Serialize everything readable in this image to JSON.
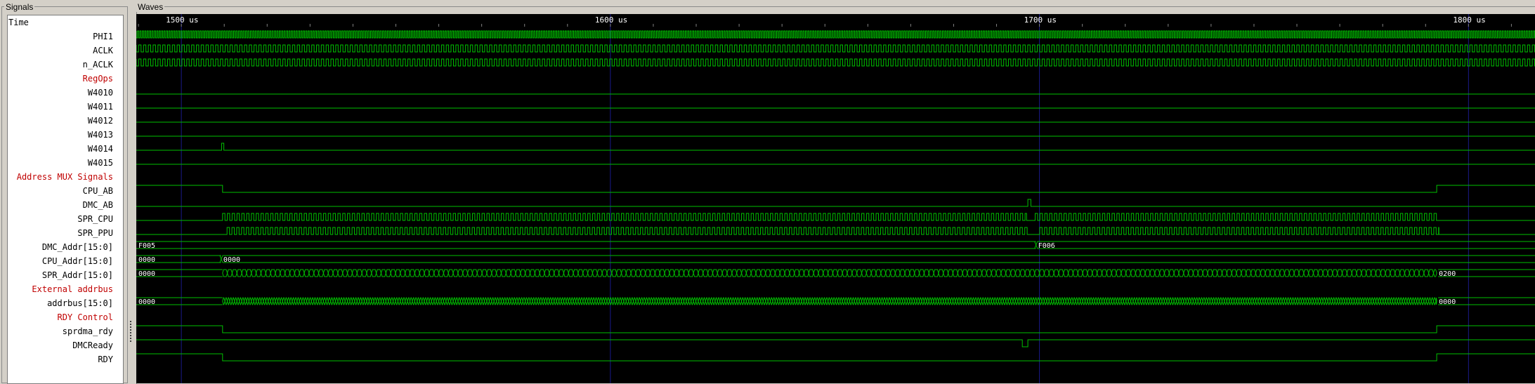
{
  "panes": {
    "signals_title": "Signals",
    "waves_title": "Waves"
  },
  "time_header": "Time",
  "colors": {
    "wave": "#00c000",
    "background": "#000000",
    "grid": "#1a1a8a",
    "section_text": "#c00000"
  },
  "timeline": {
    "start_us": 1489.5,
    "end_us": 1815.5,
    "ticks": [
      {
        "t": 1500,
        "label": "1500 us"
      },
      {
        "t": 1600,
        "label": "1600 us"
      },
      {
        "t": 1700,
        "label": "1700 us"
      },
      {
        "t": 1800,
        "label": "1800 us"
      }
    ]
  },
  "signals": [
    {
      "name": "PHI1",
      "type": "clock",
      "period_us": 0.56
    },
    {
      "name": "ACLK",
      "type": "clock",
      "period_us": 1.12
    },
    {
      "name": "n_ACLK",
      "type": "clock",
      "period_us": 1.12
    },
    {
      "name": "RegOps",
      "type": "section"
    },
    {
      "name": "W4010",
      "type": "low"
    },
    {
      "name": "W4011",
      "type": "low"
    },
    {
      "name": "W4012",
      "type": "low"
    },
    {
      "name": "W4013",
      "type": "low"
    },
    {
      "name": "W4014",
      "type": "pulses",
      "pulses": [
        [
          1509.4,
          1509.9
        ]
      ]
    },
    {
      "name": "W4015",
      "type": "low"
    },
    {
      "name": "Address MUX Signals",
      "type": "section"
    },
    {
      "name": "CPU_AB",
      "type": "edges",
      "initial": 1,
      "edges": [
        1509.6,
        1792.6
      ]
    },
    {
      "name": "DMC_AB",
      "type": "pulses",
      "pulses": [
        [
          1697.3,
          1698.0
        ]
      ]
    },
    {
      "name": "SPR_CPU",
      "type": "clockwin",
      "period_us": 1.12,
      "windows": [
        [
          1509.6,
          1697.0
        ],
        [
          1699.0,
          1792.6
        ]
      ]
    },
    {
      "name": "SPR_PPU",
      "type": "clockwin",
      "period_us": 1.12,
      "phase_us": 0.56,
      "windows": [
        [
          1510.1,
          1697.6
        ],
        [
          1699.5,
          1793.1
        ]
      ]
    },
    {
      "name": "DMC_Addr[15:0]",
      "type": "bus",
      "segments": [
        {
          "t": 1489.5,
          "label": "F005"
        },
        {
          "t": 1699.2,
          "label": "F006"
        }
      ]
    },
    {
      "name": "CPU_Addr[15:0]",
      "type": "bus",
      "segments": [
        {
          "t": 1489.5,
          "label": "0000"
        },
        {
          "t": 1509.3,
          "label": "0000"
        }
      ]
    },
    {
      "name": "SPR_Addr[15:0]",
      "type": "bus",
      "segments": [
        {
          "t": 1489.5,
          "label": "0000"
        },
        {
          "t": 1792.6,
          "label": "0200"
        }
      ],
      "busy": [
        1509.6,
        1792.6
      ],
      "busy_period_us": 1.12
    },
    {
      "name": "External addrbus",
      "type": "section"
    },
    {
      "name": "addrbus[15:0]",
      "type": "bus",
      "segments": [
        {
          "t": 1489.5,
          "label": "0000"
        },
        {
          "t": 1792.6,
          "label": "0000"
        }
      ],
      "busy": [
        1509.6,
        1792.6
      ],
      "busy_period_us": 0.56
    },
    {
      "name": "RDY Control",
      "type": "section"
    },
    {
      "name": "sprdma_rdy",
      "type": "edges",
      "initial": 1,
      "edges": [
        1509.6,
        1792.6
      ]
    },
    {
      "name": "DMCReady",
      "type": "edges",
      "initial": 1,
      "edges": [
        1696.0,
        1697.3
      ]
    },
    {
      "name": "RDY",
      "type": "edges",
      "initial": 1,
      "edges": [
        1509.6,
        1792.6
      ]
    }
  ]
}
